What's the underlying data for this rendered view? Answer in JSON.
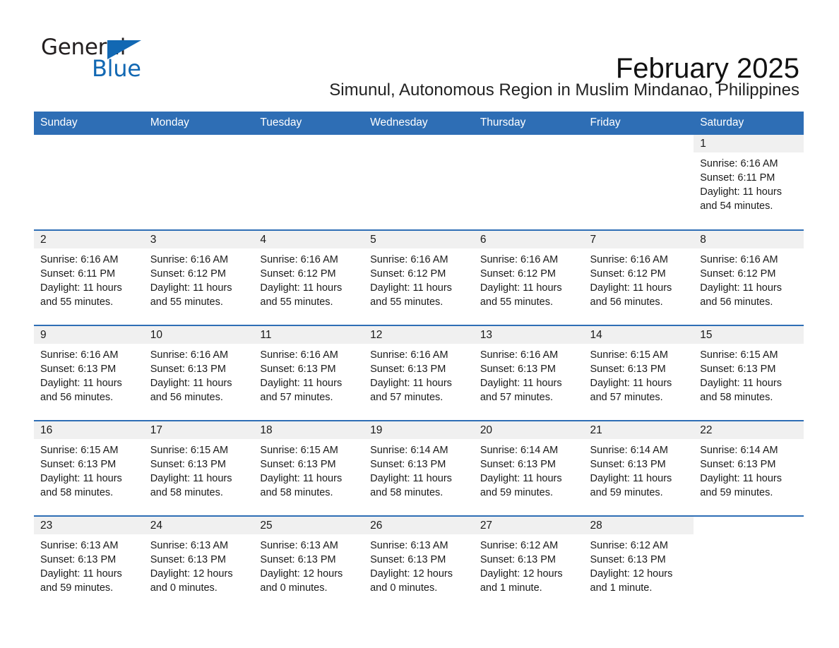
{
  "brand": {
    "word1": "General",
    "word2": "Blue",
    "triangle_color": "#1268b3",
    "text_color": "#231f20"
  },
  "header": {
    "month_title": "February 2025",
    "subtitle": "Simunul, Autonomous Region in Muslim Mindanao, Philippines"
  },
  "theme": {
    "header_blue": "#2e6eb5",
    "daynum_band": "#f0f0f0",
    "text": "#1a1a1a"
  },
  "calendar": {
    "weekday_headers": [
      "Sunday",
      "Monday",
      "Tuesday",
      "Wednesday",
      "Thursday",
      "Friday",
      "Saturday"
    ],
    "weeks": [
      [
        {
          "day": "",
          "sunrise": "",
          "sunset": "",
          "daylight": "",
          "empty": true
        },
        {
          "day": "",
          "sunrise": "",
          "sunset": "",
          "daylight": "",
          "empty": true
        },
        {
          "day": "",
          "sunrise": "",
          "sunset": "",
          "daylight": "",
          "empty": true
        },
        {
          "day": "",
          "sunrise": "",
          "sunset": "",
          "daylight": "",
          "empty": true
        },
        {
          "day": "",
          "sunrise": "",
          "sunset": "",
          "daylight": "",
          "empty": true
        },
        {
          "day": "",
          "sunrise": "",
          "sunset": "",
          "daylight": "",
          "empty": true
        },
        {
          "day": "1",
          "sunrise": "Sunrise: 6:16 AM",
          "sunset": "Sunset: 6:11 PM",
          "daylight": "Daylight: 11 hours and 54 minutes.",
          "empty": false
        }
      ],
      [
        {
          "day": "2",
          "sunrise": "Sunrise: 6:16 AM",
          "sunset": "Sunset: 6:11 PM",
          "daylight": "Daylight: 11 hours and 55 minutes.",
          "empty": false
        },
        {
          "day": "3",
          "sunrise": "Sunrise: 6:16 AM",
          "sunset": "Sunset: 6:12 PM",
          "daylight": "Daylight: 11 hours and 55 minutes.",
          "empty": false
        },
        {
          "day": "4",
          "sunrise": "Sunrise: 6:16 AM",
          "sunset": "Sunset: 6:12 PM",
          "daylight": "Daylight: 11 hours and 55 minutes.",
          "empty": false
        },
        {
          "day": "5",
          "sunrise": "Sunrise: 6:16 AM",
          "sunset": "Sunset: 6:12 PM",
          "daylight": "Daylight: 11 hours and 55 minutes.",
          "empty": false
        },
        {
          "day": "6",
          "sunrise": "Sunrise: 6:16 AM",
          "sunset": "Sunset: 6:12 PM",
          "daylight": "Daylight: 11 hours and 55 minutes.",
          "empty": false
        },
        {
          "day": "7",
          "sunrise": "Sunrise: 6:16 AM",
          "sunset": "Sunset: 6:12 PM",
          "daylight": "Daylight: 11 hours and 56 minutes.",
          "empty": false
        },
        {
          "day": "8",
          "sunrise": "Sunrise: 6:16 AM",
          "sunset": "Sunset: 6:12 PM",
          "daylight": "Daylight: 11 hours and 56 minutes.",
          "empty": false
        }
      ],
      [
        {
          "day": "9",
          "sunrise": "Sunrise: 6:16 AM",
          "sunset": "Sunset: 6:13 PM",
          "daylight": "Daylight: 11 hours and 56 minutes.",
          "empty": false
        },
        {
          "day": "10",
          "sunrise": "Sunrise: 6:16 AM",
          "sunset": "Sunset: 6:13 PM",
          "daylight": "Daylight: 11 hours and 56 minutes.",
          "empty": false
        },
        {
          "day": "11",
          "sunrise": "Sunrise: 6:16 AM",
          "sunset": "Sunset: 6:13 PM",
          "daylight": "Daylight: 11 hours and 57 minutes.",
          "empty": false
        },
        {
          "day": "12",
          "sunrise": "Sunrise: 6:16 AM",
          "sunset": "Sunset: 6:13 PM",
          "daylight": "Daylight: 11 hours and 57 minutes.",
          "empty": false
        },
        {
          "day": "13",
          "sunrise": "Sunrise: 6:16 AM",
          "sunset": "Sunset: 6:13 PM",
          "daylight": "Daylight: 11 hours and 57 minutes.",
          "empty": false
        },
        {
          "day": "14",
          "sunrise": "Sunrise: 6:15 AM",
          "sunset": "Sunset: 6:13 PM",
          "daylight": "Daylight: 11 hours and 57 minutes.",
          "empty": false
        },
        {
          "day": "15",
          "sunrise": "Sunrise: 6:15 AM",
          "sunset": "Sunset: 6:13 PM",
          "daylight": "Daylight: 11 hours and 58 minutes.",
          "empty": false
        }
      ],
      [
        {
          "day": "16",
          "sunrise": "Sunrise: 6:15 AM",
          "sunset": "Sunset: 6:13 PM",
          "daylight": "Daylight: 11 hours and 58 minutes.",
          "empty": false
        },
        {
          "day": "17",
          "sunrise": "Sunrise: 6:15 AM",
          "sunset": "Sunset: 6:13 PM",
          "daylight": "Daylight: 11 hours and 58 minutes.",
          "empty": false
        },
        {
          "day": "18",
          "sunrise": "Sunrise: 6:15 AM",
          "sunset": "Sunset: 6:13 PM",
          "daylight": "Daylight: 11 hours and 58 minutes.",
          "empty": false
        },
        {
          "day": "19",
          "sunrise": "Sunrise: 6:14 AM",
          "sunset": "Sunset: 6:13 PM",
          "daylight": "Daylight: 11 hours and 58 minutes.",
          "empty": false
        },
        {
          "day": "20",
          "sunrise": "Sunrise: 6:14 AM",
          "sunset": "Sunset: 6:13 PM",
          "daylight": "Daylight: 11 hours and 59 minutes.",
          "empty": false
        },
        {
          "day": "21",
          "sunrise": "Sunrise: 6:14 AM",
          "sunset": "Sunset: 6:13 PM",
          "daylight": "Daylight: 11 hours and 59 minutes.",
          "empty": false
        },
        {
          "day": "22",
          "sunrise": "Sunrise: 6:14 AM",
          "sunset": "Sunset: 6:13 PM",
          "daylight": "Daylight: 11 hours and 59 minutes.",
          "empty": false
        }
      ],
      [
        {
          "day": "23",
          "sunrise": "Sunrise: 6:13 AM",
          "sunset": "Sunset: 6:13 PM",
          "daylight": "Daylight: 11 hours and 59 minutes.",
          "empty": false
        },
        {
          "day": "24",
          "sunrise": "Sunrise: 6:13 AM",
          "sunset": "Sunset: 6:13 PM",
          "daylight": "Daylight: 12 hours and 0 minutes.",
          "empty": false
        },
        {
          "day": "25",
          "sunrise": "Sunrise: 6:13 AM",
          "sunset": "Sunset: 6:13 PM",
          "daylight": "Daylight: 12 hours and 0 minutes.",
          "empty": false
        },
        {
          "day": "26",
          "sunrise": "Sunrise: 6:13 AM",
          "sunset": "Sunset: 6:13 PM",
          "daylight": "Daylight: 12 hours and 0 minutes.",
          "empty": false
        },
        {
          "day": "27",
          "sunrise": "Sunrise: 6:12 AM",
          "sunset": "Sunset: 6:13 PM",
          "daylight": "Daylight: 12 hours and 1 minute.",
          "empty": false
        },
        {
          "day": "28",
          "sunrise": "Sunrise: 6:12 AM",
          "sunset": "Sunset: 6:13 PM",
          "daylight": "Daylight: 12 hours and 1 minute.",
          "empty": false
        },
        {
          "day": "",
          "sunrise": "",
          "sunset": "",
          "daylight": "",
          "empty": true
        }
      ]
    ]
  }
}
